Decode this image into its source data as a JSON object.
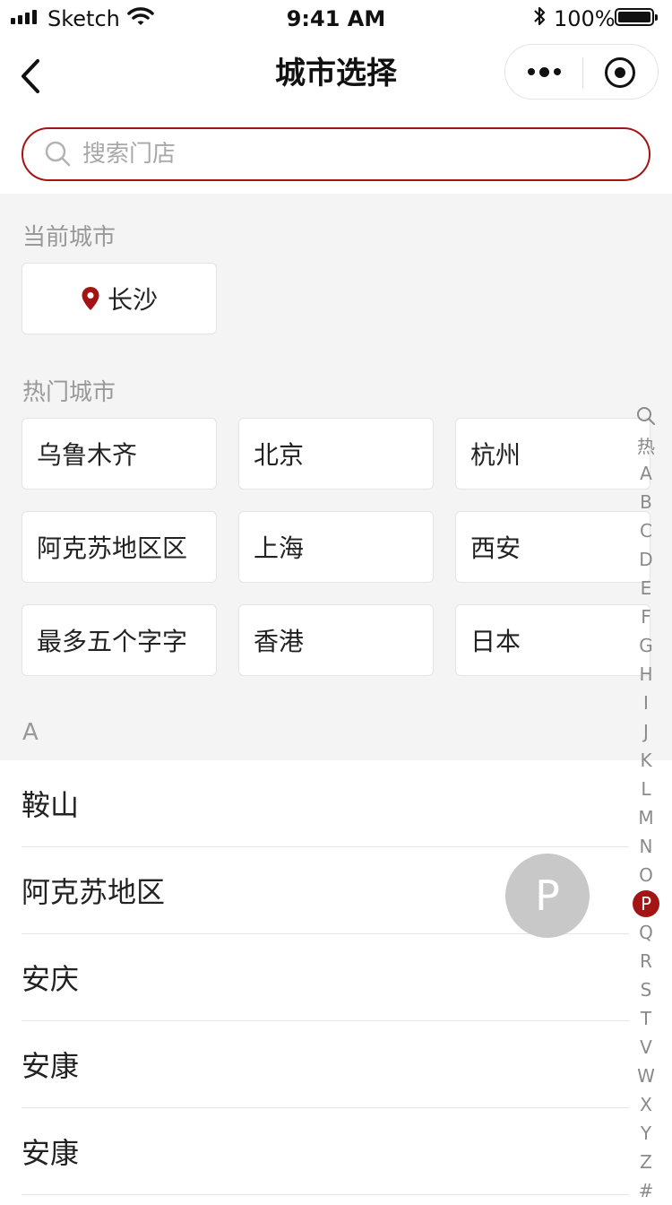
{
  "status_bar": {
    "carrier": "Sketch",
    "time": "9:41 AM",
    "battery": "100%"
  },
  "nav": {
    "title": "城市选择"
  },
  "search": {
    "placeholder": "搜索门店",
    "value": ""
  },
  "current_city": {
    "label": "当前城市",
    "city": "长沙"
  },
  "hot_cities": {
    "label": "热门城市",
    "items": [
      "乌鲁木齐",
      "北京",
      "杭州",
      "阿克苏地区区",
      "上海",
      "西安",
      "最多五个字字",
      "香港",
      "日本"
    ]
  },
  "list": {
    "section_letter": "A",
    "items": [
      "鞍山",
      "阿克苏地区",
      "安庆",
      "安康",
      "安康"
    ]
  },
  "index_bar": {
    "items": [
      "热",
      "A",
      "B",
      "C",
      "D",
      "E",
      "F",
      "G",
      "H",
      "I",
      "J",
      "K",
      "L",
      "M",
      "N",
      "O",
      "P",
      "Q",
      "R",
      "S",
      "T",
      "V",
      "W",
      "X",
      "Y",
      "Z",
      "#"
    ],
    "active": "P"
  },
  "letter_bubble": "P",
  "colors": {
    "accent": "#a31515",
    "grey_bg": "#f4f4f4"
  }
}
